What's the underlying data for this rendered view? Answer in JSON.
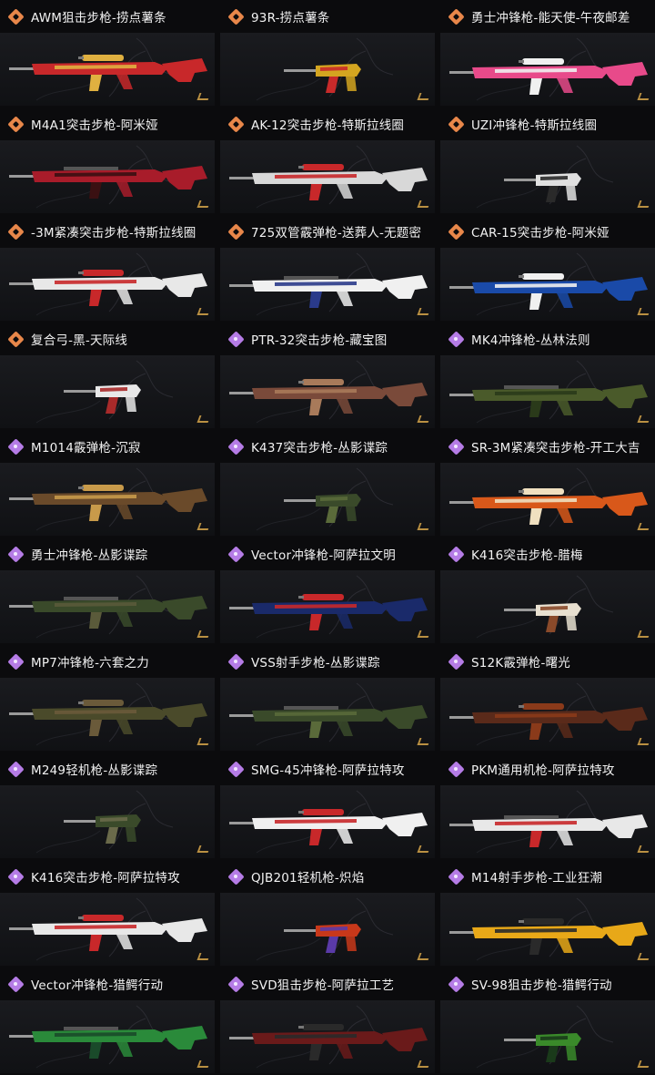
{
  "colors": {
    "orange_badge": "#e8874a",
    "purple_badge": "#b57ce6"
  },
  "items": [
    {
      "name": "AWM狙击步枪-捞点薯条",
      "rarity": "orange",
      "icon": "orange-diamond-icon",
      "accent": "#c8282a",
      "accent2": "#e0b040"
    },
    {
      "name": "93R-捞点薯条",
      "rarity": "orange",
      "icon": "orange-diamond-icon",
      "accent": "#d4a520",
      "accent2": "#c82a2a"
    },
    {
      "name": "勇士冲锋枪-能天使-午夜邮差",
      "rarity": "orange",
      "icon": "orange-diamond-icon",
      "accent": "#e84a8a",
      "accent2": "#f0f0f0"
    },
    {
      "name": "M4A1突击步枪-阿米娅",
      "rarity": "orange",
      "icon": "orange-diamond-icon",
      "accent": "#a81c2a",
      "accent2": "#3a1012"
    },
    {
      "name": "AK-12突击步枪-特斯拉线圈",
      "rarity": "orange",
      "icon": "orange-diamond-icon",
      "accent": "#d8d8d8",
      "accent2": "#c8282a"
    },
    {
      "name": "UZI冲锋枪-特斯拉线圈",
      "rarity": "orange",
      "icon": "orange-diamond-icon",
      "accent": "#e0e0e0",
      "accent2": "#2a2a2a"
    },
    {
      "name": "-3M紧凑突击步枪-特斯拉线圈",
      "rarity": "orange",
      "icon": "orange-diamond-icon",
      "accent": "#e8e8e8",
      "accent2": "#c8282a"
    },
    {
      "name": "725双管霰弹枪-送葬人-无题密",
      "rarity": "orange",
      "icon": "orange-diamond-icon",
      "accent": "#f0f0f0",
      "accent2": "#2a3a8a"
    },
    {
      "name": "CAR-15突击步枪-阿米娅",
      "rarity": "orange",
      "icon": "orange-diamond-icon",
      "accent": "#1a4aa8",
      "accent2": "#f0f0f0"
    },
    {
      "name": "复合弓-黑-天际线",
      "rarity": "orange",
      "icon": "orange-diamond-icon",
      "accent": "#e8e8e8",
      "accent2": "#a82a2a"
    },
    {
      "name": "PTR-32突击步枪-藏宝图",
      "rarity": "purple",
      "icon": "purple-diamond-icon",
      "accent": "#7a4a3a",
      "accent2": "#a87a5a"
    },
    {
      "name": "MK4冲锋枪-丛林法则",
      "rarity": "purple",
      "icon": "purple-diamond-icon",
      "accent": "#4a5a2a",
      "accent2": "#2a3a1a"
    },
    {
      "name": "M1014霰弹枪-沉寂",
      "rarity": "purple",
      "icon": "purple-diamond-icon",
      "accent": "#6a4a2a",
      "accent2": "#c89a4a"
    },
    {
      "name": "K437突击步枪-丛影谍踪",
      "rarity": "purple",
      "icon": "purple-diamond-icon",
      "accent": "#3a4a2a",
      "accent2": "#5a6a3a"
    },
    {
      "name": "SR-3M紧凑突击步枪-开工大吉",
      "rarity": "purple",
      "icon": "purple-diamond-icon",
      "accent": "#d8581a",
      "accent2": "#f0e0c0"
    },
    {
      "name": "勇士冲锋枪-丛影谍踪",
      "rarity": "purple",
      "icon": "purple-diamond-icon",
      "accent": "#3a4a2a",
      "accent2": "#5a5a3a"
    },
    {
      "name": "Vector冲锋枪-阿萨拉文明",
      "rarity": "purple",
      "icon": "purple-diamond-icon",
      "accent": "#1a2a6a",
      "accent2": "#c8282a"
    },
    {
      "name": "K416突击步枪-腊梅",
      "rarity": "purple",
      "icon": "purple-diamond-icon",
      "accent": "#e8e0d0",
      "accent2": "#8a4a2a"
    },
    {
      "name": "MP7冲锋枪-六套之力",
      "rarity": "purple",
      "icon": "purple-diamond-icon",
      "accent": "#4a4a2a",
      "accent2": "#6a5a3a"
    },
    {
      "name": "VSS射手步枪-丛影谍踪",
      "rarity": "purple",
      "icon": "purple-diamond-icon",
      "accent": "#3a4a2a",
      "accent2": "#5a6a3a"
    },
    {
      "name": "S12K霰弹枪-曙光",
      "rarity": "purple",
      "icon": "purple-diamond-icon",
      "accent": "#5a2a1a",
      "accent2": "#8a3a1a"
    },
    {
      "name": "M249轻机枪-丛影谍踪",
      "rarity": "purple",
      "icon": "purple-diamond-icon",
      "accent": "#3a4a2a",
      "accent2": "#6a6a4a"
    },
    {
      "name": "SMG-45冲锋枪-阿萨拉特攻",
      "rarity": "purple",
      "icon": "purple-diamond-icon",
      "accent": "#f0f0f0",
      "accent2": "#c8282a"
    },
    {
      "name": "PKM通用机枪-阿萨拉特攻",
      "rarity": "purple",
      "icon": "purple-diamond-icon",
      "accent": "#e8e8e8",
      "accent2": "#c8282a"
    },
    {
      "name": "K416突击步枪-阿萨拉特攻",
      "rarity": "purple",
      "icon": "purple-diamond-icon",
      "accent": "#e8e8e8",
      "accent2": "#c8282a"
    },
    {
      "name": "QJB201轻机枪-炽焰",
      "rarity": "purple",
      "icon": "purple-diamond-icon",
      "accent": "#c8381a",
      "accent2": "#5a3aa8"
    },
    {
      "name": "M14射手步枪-工业狂潮",
      "rarity": "purple",
      "icon": "purple-diamond-icon",
      "accent": "#e8a818",
      "accent2": "#2a2a2a"
    },
    {
      "name": "Vector冲锋枪-猎鳄行动",
      "rarity": "purple",
      "icon": "purple-diamond-icon",
      "accent": "#2a8a3a",
      "accent2": "#1a4a2a"
    },
    {
      "name": "SVD狙击步枪-阿萨拉工艺",
      "rarity": "purple",
      "icon": "purple-diamond-icon",
      "accent": "#6a1a1a",
      "accent2": "#2a2a2a"
    },
    {
      "name": "SV-98狙击步枪-猎鳄行动",
      "rarity": "purple",
      "icon": "purple-diamond-icon",
      "accent": "#3a8a2a",
      "accent2": "#1a3a1a"
    }
  ]
}
